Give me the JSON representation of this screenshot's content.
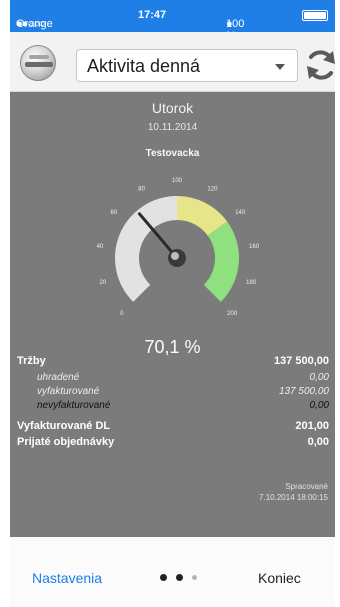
{
  "status_bar": {
    "signal_dots": "●●○○○",
    "carrier": "Orange",
    "time": "17:47",
    "battery": "100 %"
  },
  "toolbar": {
    "dropdown_value": "Aktivita denná"
  },
  "report": {
    "day": "Utorok",
    "date": "10.11.2014",
    "store": "Testovacka",
    "gauge": {
      "ticks": [
        "0",
        "20",
        "40",
        "60",
        "80",
        "100",
        "120",
        "140",
        "160",
        "180",
        "200"
      ],
      "min": 0,
      "max": 200,
      "value": 70.1,
      "zones": [
        {
          "from": 0,
          "to": 100,
          "color": "#e2e2e2"
        },
        {
          "from": 100,
          "to": 140,
          "color": "#e6e58a"
        },
        {
          "from": 140,
          "to": 200,
          "color": "#8fe07f"
        }
      ]
    },
    "percent": "70,1 %",
    "rows": [
      {
        "label": "Tržby",
        "value": "137 500,00",
        "style": "bold"
      },
      {
        "label": "uhradené",
        "value": "0,00",
        "style": "sub"
      },
      {
        "label": "vyfakturované",
        "value": "137 500,00",
        "style": "sub"
      },
      {
        "label": "nevyfakturované",
        "value": "0,00",
        "style": "sub dark"
      },
      {
        "label": "Vyfakturované DL",
        "value": "201,00",
        "style": "bold"
      },
      {
        "label": "Prijaté objednávky",
        "value": "0,00",
        "style": "bold"
      }
    ],
    "processed_label": "Spracované",
    "processed_at": "7.10.2014 18:00:15"
  },
  "tabbar": {
    "left": "Nastavenia",
    "right": "Koniec",
    "dots": 3,
    "active_dots": 2
  },
  "colors": {
    "accent": "#1f7fe6",
    "panel": "#7b7b7b"
  }
}
